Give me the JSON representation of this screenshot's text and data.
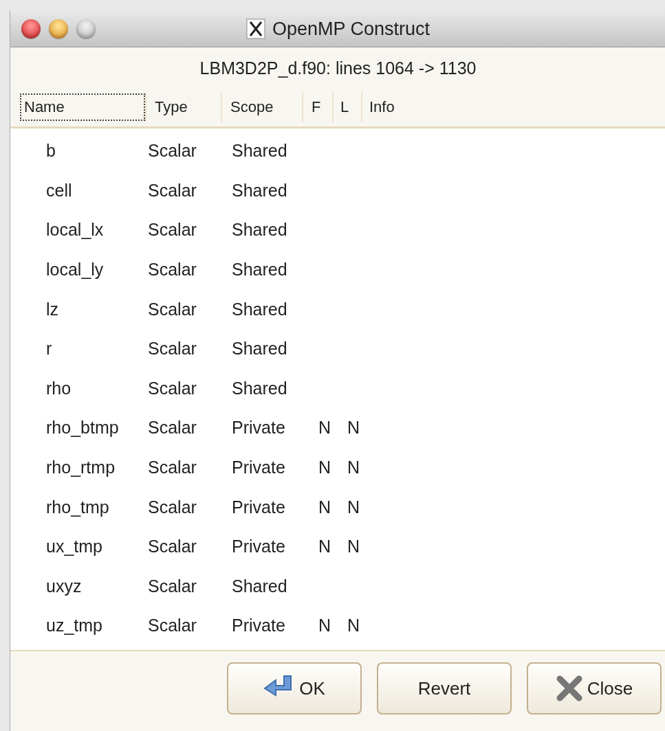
{
  "window": {
    "title": "OpenMP Construct"
  },
  "subtitle": "LBM3D2P_d.f90: lines 1064 -> 1130",
  "table": {
    "columns": [
      {
        "label": "Name",
        "selected": true
      },
      {
        "label": "Type",
        "selected": false
      },
      {
        "label": "Scope",
        "selected": false
      },
      {
        "label": "F",
        "selected": false
      },
      {
        "label": "L",
        "selected": false
      },
      {
        "label": "Info",
        "selected": false
      }
    ],
    "rows": [
      {
        "name": "b",
        "type": "Scalar",
        "scope": "Shared"
      },
      {
        "name": "cell",
        "type": "Scalar",
        "scope": "Shared"
      },
      {
        "name": "local_lx",
        "type": "Scalar",
        "scope": "Shared"
      },
      {
        "name": "local_ly",
        "type": "Scalar",
        "scope": "Shared"
      },
      {
        "name": "lz",
        "type": "Scalar",
        "scope": "Shared"
      },
      {
        "name": "r",
        "type": "Scalar",
        "scope": "Shared"
      },
      {
        "name": "rho",
        "type": "Scalar",
        "scope": "Shared"
      },
      {
        "name": "rho_btmp",
        "type": "Scalar",
        "scope": "Private",
        "f": "N",
        "l": "N"
      },
      {
        "name": "rho_rtmp",
        "type": "Scalar",
        "scope": "Private",
        "f": "N",
        "l": "N"
      },
      {
        "name": "rho_tmp",
        "type": "Scalar",
        "scope": "Private",
        "f": "N",
        "l": "N"
      },
      {
        "name": "ux_tmp",
        "type": "Scalar",
        "scope": "Private",
        "f": "N",
        "l": "N"
      },
      {
        "name": "uxyz",
        "type": "Scalar",
        "scope": "Shared"
      },
      {
        "name": "uz_tmp",
        "type": "Scalar",
        "scope": "Private",
        "f": "N",
        "l": "N"
      }
    ]
  },
  "buttons": [
    {
      "label": "OK",
      "kind": "ok"
    },
    {
      "label": "Revert",
      "kind": "plain"
    },
    {
      "label": "Close",
      "kind": "close"
    }
  ]
}
